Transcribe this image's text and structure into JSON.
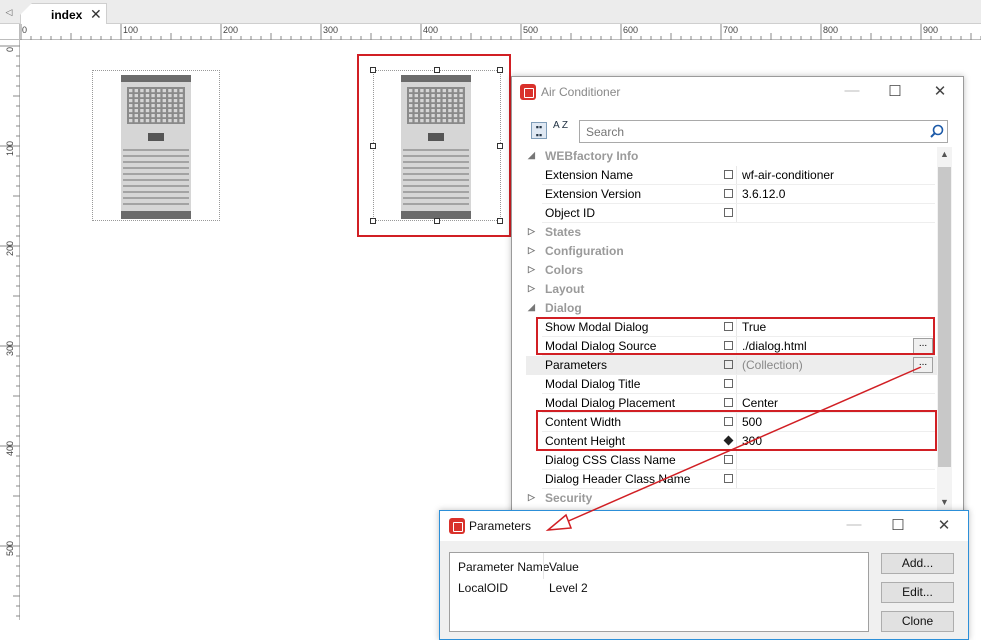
{
  "tabs": [
    {
      "label": "index",
      "close": "✕"
    }
  ],
  "ruler": {
    "horizontal": [
      "0",
      "100",
      "200",
      "300",
      "400",
      "500",
      "600",
      "700",
      "800",
      "900"
    ],
    "vertical": [
      "0",
      "100",
      "200",
      "300",
      "400",
      "500"
    ]
  },
  "property_window": {
    "title": "Air Conditioner",
    "search_placeholder": "Search",
    "sort_icon_label": "A Z",
    "rows": [
      {
        "kind": "category",
        "label": "WEBfactory Info",
        "expanded": true
      },
      {
        "kind": "property",
        "label": "Extension Name",
        "value": "wf-air-conditioner"
      },
      {
        "kind": "property",
        "label": "Extension Version",
        "value": "3.6.12.0"
      },
      {
        "kind": "property",
        "label": "Object ID",
        "value": ""
      },
      {
        "kind": "category",
        "label": "States",
        "expanded": false
      },
      {
        "kind": "category",
        "label": "Configuration",
        "expanded": false
      },
      {
        "kind": "category",
        "label": "Colors",
        "expanded": false
      },
      {
        "kind": "category",
        "label": "Layout",
        "expanded": false
      },
      {
        "kind": "category",
        "label": "Dialog",
        "expanded": true
      },
      {
        "kind": "property",
        "label": "Show Modal Dialog",
        "value": "True"
      },
      {
        "kind": "property",
        "label": "Modal Dialog Source",
        "value": "./dialog.html",
        "button": "..."
      },
      {
        "kind": "property",
        "label": "Parameters",
        "value": "(Collection)",
        "button": "...",
        "selected": true
      },
      {
        "kind": "property",
        "label": "Modal Dialog Title",
        "value": ""
      },
      {
        "kind": "property",
        "label": "Modal Dialog Placement",
        "value": "Center"
      },
      {
        "kind": "property",
        "label": "Content Width",
        "value": "500"
      },
      {
        "kind": "property",
        "label": "Content Height",
        "value": "300",
        "bound": true
      },
      {
        "kind": "property",
        "label": "Dialog CSS Class Name",
        "value": ""
      },
      {
        "kind": "property",
        "label": "Dialog Header Class Name",
        "value": ""
      },
      {
        "kind": "category",
        "label": "Security",
        "expanded": false
      }
    ]
  },
  "parameters_dialog": {
    "title": "Parameters",
    "columns": [
      "Parameter Name",
      "Value"
    ],
    "rows": [
      {
        "name": "LocalOID",
        "value": "Level 2"
      }
    ],
    "buttons": [
      "Add...",
      "Edit...",
      "Clone"
    ]
  },
  "colors": {
    "highlight": "#d11f24",
    "brand": "#d9312b"
  },
  "icons": {
    "close": "✕",
    "maximize": "☐",
    "minimize": "—",
    "collapsed": "▷",
    "expanded": "◢",
    "search": "search-icon"
  }
}
